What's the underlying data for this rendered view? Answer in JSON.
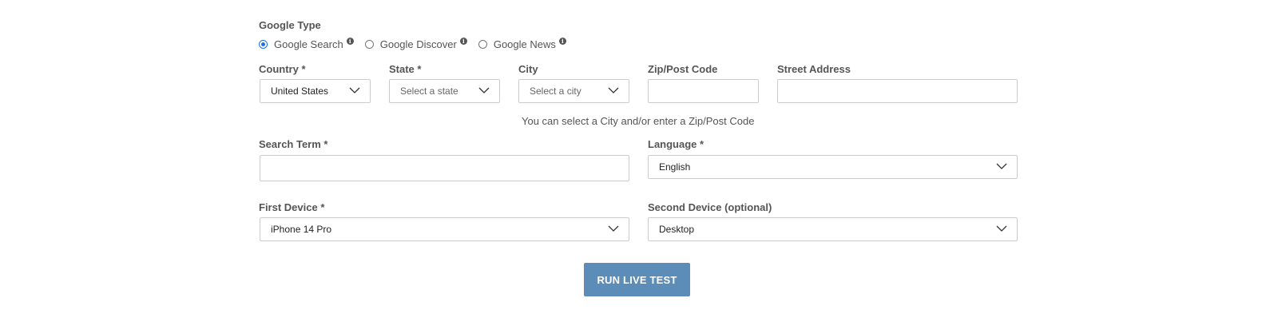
{
  "google_type": {
    "label": "Google Type",
    "options": [
      {
        "label": "Google Search",
        "checked": true
      },
      {
        "label": "Google Discover",
        "checked": false
      },
      {
        "label": "Google News",
        "checked": false
      }
    ],
    "info_icon_glyph": "i"
  },
  "location": {
    "country": {
      "label": "Country *",
      "value": "United States"
    },
    "state": {
      "label": "State *",
      "placeholder": "Select a state"
    },
    "city": {
      "label": "City",
      "placeholder": "Select a city"
    },
    "zip": {
      "label": "Zip/Post Code",
      "value": ""
    },
    "street": {
      "label": "Street Address",
      "value": ""
    },
    "hint": "You can select a City and/or enter a Zip/Post Code"
  },
  "search": {
    "term": {
      "label": "Search Term *",
      "value": ""
    },
    "language": {
      "label": "Language *",
      "value": "English"
    }
  },
  "devices": {
    "first": {
      "label": "First Device *",
      "value": "iPhone 14 Pro"
    },
    "second": {
      "label": "Second Device (optional)",
      "value": "Desktop"
    }
  },
  "actions": {
    "run_label": "RUN LIVE TEST"
  },
  "colors": {
    "button_bg": "#5b8db8",
    "radio_checked": "#1a73e8",
    "label_text": "#555555",
    "border": "#cccccc"
  }
}
